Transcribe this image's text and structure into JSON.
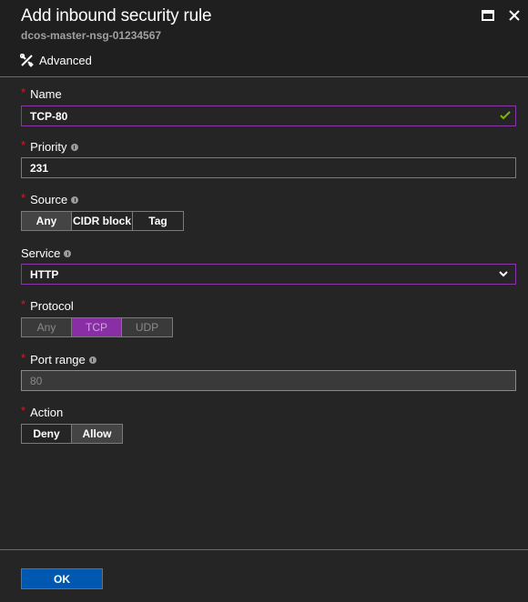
{
  "header": {
    "title": "Add inbound security rule",
    "subtitle": "dcos-master-nsg-01234567",
    "advanced_label": "Advanced",
    "maximize_icon": "maximize-icon",
    "close_icon": "close-icon"
  },
  "form": {
    "name": {
      "label": "Name",
      "required": "*",
      "value": "TCP-80",
      "valid": true
    },
    "priority": {
      "label": "Priority",
      "required": "*",
      "value": "231"
    },
    "source": {
      "label": "Source",
      "required": "*",
      "options": [
        "Any",
        "CIDR block",
        "Tag"
      ],
      "selected": "Any"
    },
    "service": {
      "label": "Service",
      "value": "HTTP"
    },
    "protocol": {
      "label": "Protocol",
      "required": "*",
      "options": [
        "Any",
        "TCP",
        "UDP"
      ],
      "selected": "TCP",
      "disabled": true
    },
    "port_range": {
      "label": "Port range",
      "required": "*",
      "value": "80",
      "disabled": true
    },
    "action": {
      "label": "Action",
      "required": "*",
      "options": [
        "Deny",
        "Allow"
      ],
      "selected": "Allow"
    }
  },
  "footer": {
    "ok_label": "OK"
  },
  "colors": {
    "background": "#252525",
    "focus_border": "#8a36a8",
    "selected_protocol": "#8a2ea6",
    "primary_button": "#0058b0",
    "valid_check": "#7fba00",
    "required_star": "#e81123"
  }
}
